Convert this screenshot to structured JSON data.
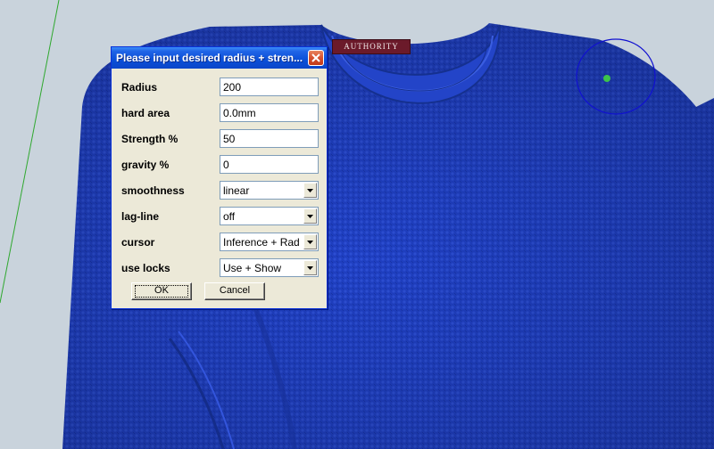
{
  "shirt": {
    "label_text": "AUTHORITY"
  },
  "dialog": {
    "title": "Please input desired radius + stren...",
    "fields": [
      {
        "label": "Radius",
        "type": "text",
        "value": "200"
      },
      {
        "label": "hard area",
        "type": "text",
        "value": "0.0mm"
      },
      {
        "label": "Strength %",
        "type": "text",
        "value": "50"
      },
      {
        "label": "gravity %",
        "type": "text",
        "value": "0"
      },
      {
        "label": "smoothness",
        "type": "select",
        "value": "linear"
      },
      {
        "label": "lag-line",
        "type": "select",
        "value": "off"
      },
      {
        "label": "cursor",
        "type": "select",
        "value": "Inference + Rad"
      },
      {
        "label": "use locks",
        "type": "select",
        "value": "Use + Show"
      }
    ],
    "ok_label": "OK",
    "cancel_label": "Cancel"
  },
  "colors": {
    "viewport_bg": "#c9d3dc",
    "shirt": "#1f3fc2",
    "titlebar": "#0a4fd8",
    "dialog_bg": "#ece9d8",
    "close_button": "#d6502e",
    "cursor_dot": "#3cc44a",
    "cursor_circle": "#1010d0"
  }
}
